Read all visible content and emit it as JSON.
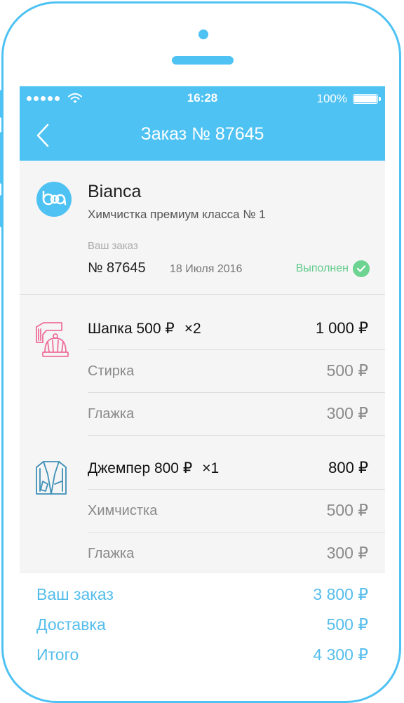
{
  "status_bar": {
    "time": "16:28",
    "battery": "100%"
  },
  "nav": {
    "title": "Заказ № 87645"
  },
  "shop": {
    "name": "Bianca",
    "subtitle": "Химчистка премиум класса № 1",
    "order_caption": "Ваш заказ",
    "order_number": "№ 87645",
    "order_date": "18 Июля 2016",
    "status": "Выполнен"
  },
  "items": [
    {
      "name": "Шапка 500 ₽",
      "qty": "×2",
      "total": "1 000 ₽",
      "icon": "hat-scarf-icon",
      "services": [
        {
          "label": "Стирка",
          "price": "500 ₽"
        },
        {
          "label": "Глажка",
          "price": "300 ₽"
        }
      ]
    },
    {
      "name": "Джемпер 800 ₽",
      "qty": "×1",
      "total": "800 ₽",
      "icon": "jumper-icon",
      "services": [
        {
          "label": "Химчистка",
          "price": "500 ₽"
        },
        {
          "label": "Глажка",
          "price": "300 ₽"
        }
      ]
    }
  ],
  "totals": [
    {
      "label": "Ваш заказ",
      "value": "3 800 ₽"
    },
    {
      "label": "Доставка",
      "value": "500 ₽"
    },
    {
      "label": "Итого",
      "value": "4 300 ₽"
    }
  ],
  "colors": {
    "accent": "#4ec2f3",
    "success": "#6dd391",
    "hat_icon": "#ee6f9c",
    "jumper_icon": "#3d8fb7"
  }
}
